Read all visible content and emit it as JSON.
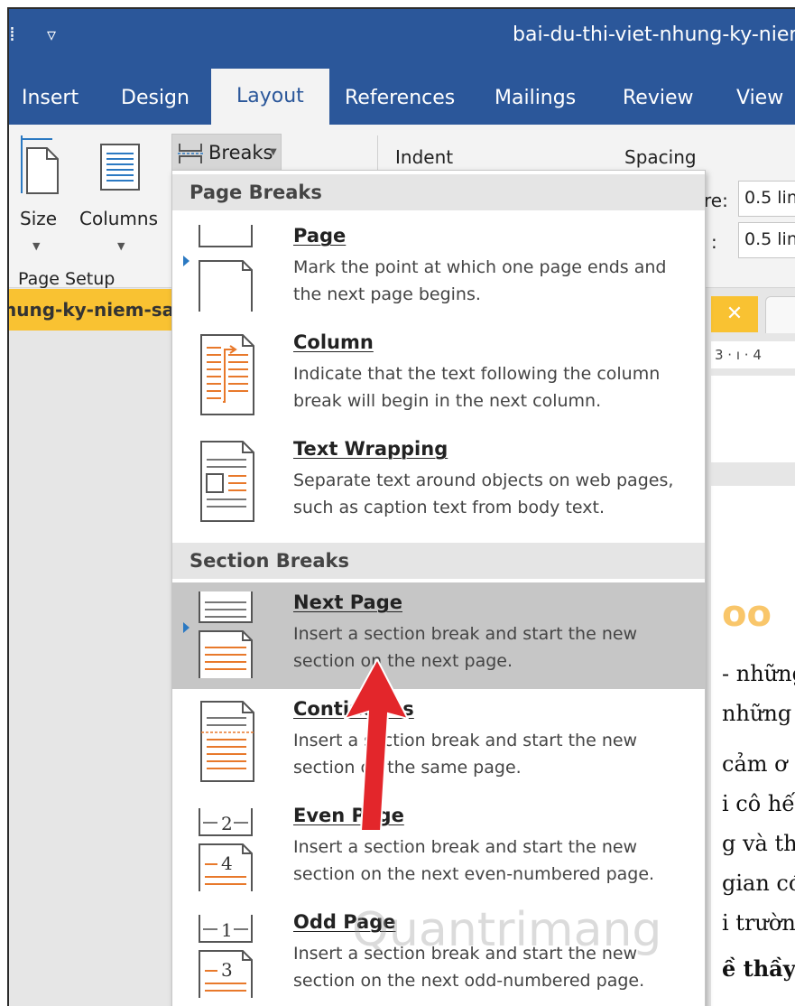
{
  "window": {
    "title": "bai-du-thi-viet-nhung-ky-niem",
    "qat": [
      "save-icon",
      "customize-qat-icon"
    ]
  },
  "ribbon_tabs": [
    "Insert",
    "Design",
    "Layout",
    "References",
    "Mailings",
    "Review",
    "View"
  ],
  "active_tab": "Layout",
  "ribbon": {
    "size_label": "Size",
    "columns_label": "Columns",
    "breaks_label": "Breaks",
    "indent_label": "Indent",
    "spacing_label": "Spacing",
    "spacing_before_label": "re:",
    "spacing_after_label": ":",
    "spacing_before_value": "0.5 lin",
    "spacing_after_value": "0.5 lin",
    "group_page_setup": "Page Setup"
  },
  "document": {
    "tab_label": "hung-ky-niem-sa",
    "ruler_text": "3 · ı · 4",
    "lines": [
      "- những",
      "những",
      "cảm ơ",
      "i cô hế",
      "g và th",
      "gian có",
      "i trườn",
      "ề thầy"
    ],
    "logo_fragment": "oo"
  },
  "menu": {
    "page_breaks_header": "Page Breaks",
    "section_breaks_header": "Section Breaks",
    "items": [
      {
        "title": "Page",
        "desc": "Mark the point at which one page ends and the next page begins."
      },
      {
        "title": "Column",
        "desc": "Indicate that the text following the column break will begin in the next column."
      },
      {
        "title": "Text Wrapping",
        "desc": "Separate text around objects on web pages, such as caption text from body text."
      },
      {
        "title": "Next Page",
        "desc": "Insert a section break and start the new section on the next page."
      },
      {
        "title": "Continuous",
        "desc": "Insert a section break and start the new section on the same page."
      },
      {
        "title": "Even Page",
        "desc": "Insert a section break and start the new section on the next even-numbered page."
      },
      {
        "title": "Odd Page",
        "desc": "Insert a section break and start the new section on the next odd-numbered page."
      }
    ],
    "highlighted": "Next Page"
  },
  "watermark": "Quantrimang",
  "colors": {
    "word_blue": "#2b579a",
    "doc_tab_yellow": "#f9c232",
    "arrow_red": "#e3262b",
    "icon_orange": "#e8792b",
    "highlight_gray": "#c6c6c6"
  }
}
